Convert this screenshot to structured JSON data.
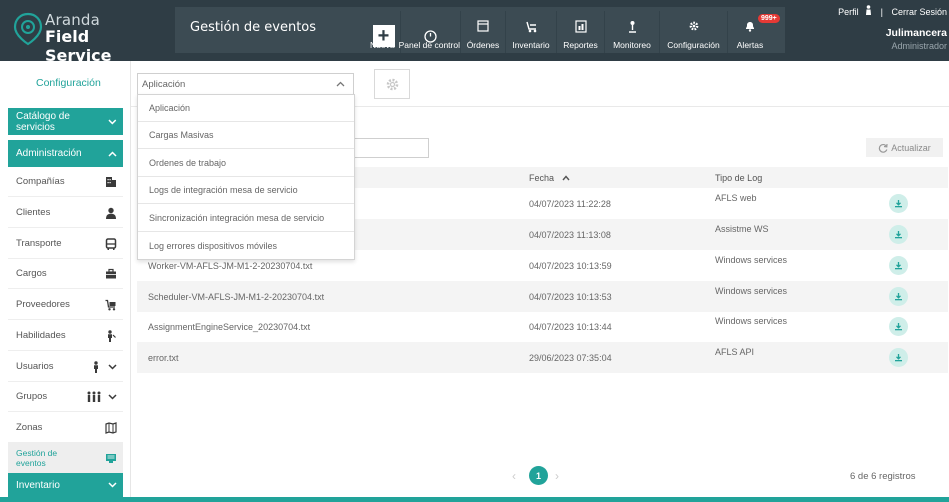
{
  "brand": {
    "line1": "Aranda",
    "line2": "Field Service",
    "accent": "#21a39a",
    "header_bg": "#2f3d45"
  },
  "header": {
    "module_title": "Gestión de eventos",
    "nav": [
      {
        "label": "Nueva",
        "icon": "plus-icon"
      },
      {
        "label": "Panel de control",
        "icon": "dashboard-icon"
      },
      {
        "label": "Órdenes",
        "icon": "orders-icon"
      },
      {
        "label": "Inventario",
        "icon": "inventory-icon"
      },
      {
        "label": "Reportes",
        "icon": "reports-icon"
      },
      {
        "label": "Monitoreo",
        "icon": "monitoring-icon"
      },
      {
        "label": "Configuración",
        "icon": "gear-icon"
      },
      {
        "label": "Alertas",
        "icon": "bell-icon",
        "badge": "999+"
      }
    ],
    "profile_label": "Perfil",
    "separator": "|",
    "logout_label": "Cerrar Sesión",
    "user_name": "Julimancera",
    "user_role": "Administrador"
  },
  "sidebar": {
    "title": "Configuración",
    "catalog_label": "Catálogo de servicios",
    "admin_label": "Administración",
    "items": [
      {
        "label": "Compañías",
        "icon": "building-icon"
      },
      {
        "label": "Clientes",
        "icon": "person-icon"
      },
      {
        "label": "Transporte",
        "icon": "bus-icon"
      },
      {
        "label": "Cargos",
        "icon": "briefcase-icon"
      },
      {
        "label": "Proveedores",
        "icon": "cart-icon"
      },
      {
        "label": "Habilidades",
        "icon": "skill-icon"
      },
      {
        "label": "Usuarios",
        "icon": "user-icon"
      },
      {
        "label": "Grupos",
        "icon": "group-icon"
      },
      {
        "label": "Zonas",
        "icon": "map-icon"
      },
      {
        "label": "Gestión de eventos",
        "icon": "events-icon"
      }
    ],
    "inventory_label": "Inventario"
  },
  "filter": {
    "selected": "Aplicación",
    "options": [
      "Aplicación",
      "Cargas Masivas",
      "Ordenes de trabajo",
      "Logs de integración mesa de servicio",
      "Sincronización integración mesa de servicio",
      "Log errores dispositivos móviles"
    ]
  },
  "search": {
    "value": ""
  },
  "refresh_label": "Actualizar",
  "table": {
    "headers": {
      "date": "Fecha",
      "type": "Tipo de Log"
    },
    "rows": [
      {
        "name": "",
        "date": "04/07/2023 11:22:28",
        "type": "AFLS web"
      },
      {
        "name": "",
        "date": "04/07/2023 11:13:08",
        "type": "Assistme WS"
      },
      {
        "name": "Worker-VM-AFLS-JM-M1-2-20230704.txt",
        "date": "04/07/2023 10:13:59",
        "type": "Windows services"
      },
      {
        "name": "Scheduler-VM-AFLS-JM-M1-2-20230704.txt",
        "date": "04/07/2023 10:13:53",
        "type": "Windows services"
      },
      {
        "name": "AssignmentEngineService_20230704.txt",
        "date": "04/07/2023 10:13:44",
        "type": "Windows services"
      },
      {
        "name": "error.txt",
        "date": "29/06/2023 07:35:04",
        "type": "AFLS API"
      }
    ]
  },
  "pagination": {
    "current": "1",
    "records": "6 de 6 registros"
  }
}
